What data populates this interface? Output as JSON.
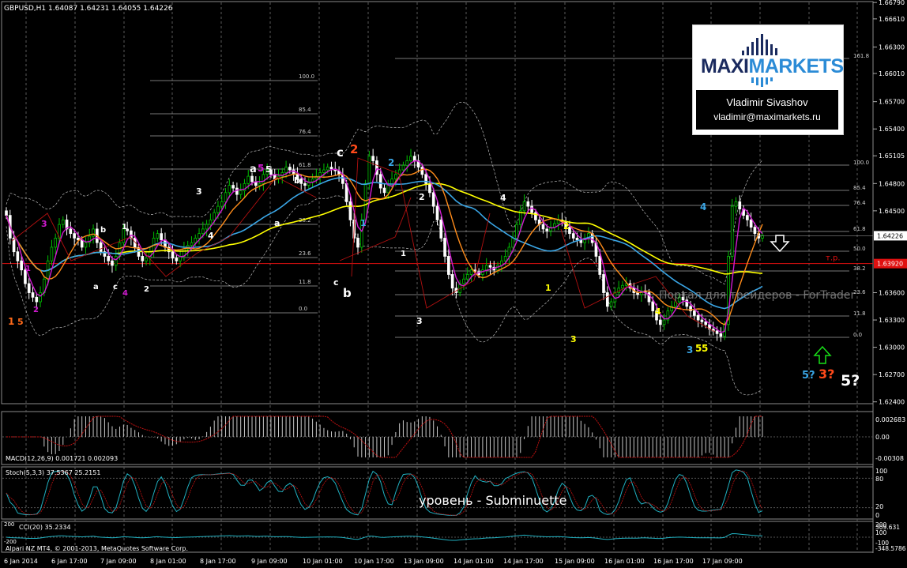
{
  "window": {
    "symbol_header": "GBPUSD,H1  1.64087 1.64231 1.64055 1.64226",
    "footer": "Alpari NZ MT4, © 2001-2013, MetaQuotes Software Corp."
  },
  "logo": {
    "brand_left": "MAXI",
    "brand_right": "MARKETS",
    "author_name": "Vladimir Sivashov",
    "author_email": "vladimir@maximarkets.ru"
  },
  "watermark": "Портал для трейдеров - ForTrader",
  "level_caption": "уровень - Subminuette",
  "colors": {
    "bg": "#000000",
    "grid": "#5a5a5a",
    "bull": "#00c000",
    "bear": "#ffffff",
    "ma_yellow": "#ffff00",
    "ma_blue": "#3aa6e6",
    "ma_orange": "#ff8c1a",
    "ma_magenta": "#d01ad0",
    "tp_line": "#e01010",
    "fib_line": "#a0a0a0",
    "macd": "#c01010",
    "stoch": "#20b0c0",
    "cci": "#20b0c0"
  },
  "chart_data": [
    {
      "type": "candlestick",
      "symbol": "GBPUSD",
      "timeframe": "H1",
      "ohlc_header": {
        "open": 1.64087,
        "high": 1.64231,
        "low": 1.64055,
        "close": 1.64226
      },
      "ylim": [
        1.6238,
        1.668
      ],
      "y_ticks": [
        "1.66790",
        "1.66610",
        "1.66300",
        "1.66010",
        "1.65700",
        "1.65400",
        "1.65105",
        "1.64800",
        "1.64500",
        "1.64226",
        "1.63920",
        "1.63600",
        "1.63300",
        "1.63000",
        "1.62700",
        "1.62400"
      ],
      "current_price_label": "1.64226",
      "tp_price_label": "1.63920",
      "tp_label": "т.р.",
      "x_ticks": [
        "6 Jan 2014",
        "6 Jan 17:00",
        "7 Jan 09:00",
        "8 Jan 01:00",
        "8 Jan 17:00",
        "9 Jan 09:00",
        "10 Jan 01:00",
        "10 Jan 17:00",
        "13 Jan 09:00",
        "14 Jan 01:00",
        "14 Jan 17:00",
        "15 Jan 09:00",
        "16 Jan 01:00",
        "16 Jan 17:00",
        "17 Jan 09:00"
      ],
      "closes": [
        1.6445,
        1.642,
        1.6405,
        1.6395,
        1.6385,
        1.637,
        1.636,
        1.6355,
        1.635,
        1.636,
        1.6375,
        1.6395,
        1.641,
        1.642,
        1.6435,
        1.644,
        1.643,
        1.6425,
        1.642,
        1.6418,
        1.641,
        1.6415,
        1.6422,
        1.643,
        1.6415,
        1.6405,
        1.64,
        1.6395,
        1.639,
        1.64,
        1.6415,
        1.643,
        1.6428,
        1.642,
        1.641,
        1.64,
        1.6395,
        1.6398,
        1.6405,
        1.642,
        1.6425,
        1.6418,
        1.641,
        1.6405,
        1.6398,
        1.6395,
        1.64,
        1.6408,
        1.6412,
        1.6415,
        1.642,
        1.6425,
        1.643,
        1.6435,
        1.644,
        1.6448,
        1.6455,
        1.646,
        1.647,
        1.6478,
        1.6475,
        1.6468,
        1.6472,
        1.648,
        1.6488,
        1.6482,
        1.6478,
        1.648,
        1.649,
        1.6495,
        1.649,
        1.6485,
        1.6488,
        1.6492,
        1.6498,
        1.6495,
        1.649,
        1.6485,
        1.648,
        1.6478,
        1.6482,
        1.6485,
        1.6488,
        1.6492,
        1.6495,
        1.6498,
        1.6496,
        1.6494,
        1.649,
        1.648,
        1.646,
        1.644,
        1.642,
        1.641,
        1.644,
        1.648,
        1.651,
        1.6505,
        1.649,
        1.6475,
        1.647,
        1.6478,
        1.6485,
        1.649,
        1.6495,
        1.65,
        1.6505,
        1.651,
        1.6505,
        1.6498,
        1.649,
        1.648,
        1.647,
        1.6455,
        1.644,
        1.642,
        1.64,
        1.638,
        1.6365,
        1.636,
        1.637,
        1.6375,
        1.638,
        1.6385,
        1.6383,
        1.638,
        1.6385,
        1.639,
        1.6388,
        1.6385,
        1.639,
        1.6395,
        1.64,
        1.641,
        1.642,
        1.6435,
        1.645,
        1.646,
        1.6455,
        1.6448,
        1.644,
        1.6435,
        1.643,
        1.6428,
        1.6432,
        1.6436,
        1.644,
        1.6438,
        1.6432,
        1.6425,
        1.642,
        1.6418,
        1.6415,
        1.642,
        1.6425,
        1.6415,
        1.64,
        1.638,
        1.636,
        1.6345,
        1.635,
        1.636,
        1.6365,
        1.6368,
        1.637,
        1.6365,
        1.636,
        1.6358,
        1.6362,
        1.636,
        1.635,
        1.634,
        1.633,
        1.6325,
        1.633,
        1.634,
        1.6345,
        1.635,
        1.6355,
        1.6352,
        1.6345,
        1.634,
        1.6335,
        1.633,
        1.6328,
        1.6325,
        1.632,
        1.6318,
        1.6315,
        1.6312,
        1.6325,
        1.64,
        1.6455,
        1.646,
        1.6452,
        1.6445,
        1.644,
        1.6432,
        1.6425,
        1.642,
        1.6423
      ]
    },
    {
      "type": "line",
      "name": "MACD(12,26,9) 0.001721 0.002093",
      "y_ticks": [
        "0.002683",
        "0.00",
        "-0.00308"
      ]
    },
    {
      "type": "line",
      "name": "Stoch(5,3,3) 37.5367 25.2151",
      "y_ticks": [
        "100",
        "80",
        "20",
        "0"
      ]
    },
    {
      "type": "line",
      "name": "CCI(20) 35.2334",
      "y_ticks": [
        "200",
        "309.631",
        "100",
        "-100",
        "-348.5786"
      ],
      "left_ticks": [
        "200",
        "-200"
      ]
    }
  ],
  "fib_left": [
    "100.0",
    "85.4",
    "76.4",
    "61.8",
    "38.2",
    "23.6",
    "11.8",
    "0.0"
  ],
  "fib_right": [
    "161.8",
    "100.0",
    "85.4",
    "76.4",
    "61.8",
    "50.0",
    "38.2",
    "23.6",
    "11.8",
    "0.0"
  ],
  "wave_labels": [
    {
      "text": "1",
      "color": "#ff6a1a"
    },
    {
      "text": "5",
      "color": "#ff6a1a"
    },
    {
      "text": "3",
      "color": "#d01ad0"
    },
    {
      "text": "1",
      "color": "#d01ad0"
    },
    {
      "text": "2",
      "color": "#d01ad0"
    },
    {
      "text": "b",
      "color": "#ffffff"
    },
    {
      "text": "1",
      "color": "#ffffff"
    },
    {
      "text": "a",
      "color": "#ffffff"
    },
    {
      "text": "c",
      "color": "#ffffff"
    },
    {
      "text": "4",
      "color": "#d01ad0"
    },
    {
      "text": "2",
      "color": "#ffffff"
    },
    {
      "text": "3",
      "color": "#ffffff"
    },
    {
      "text": "4",
      "color": "#ffffff"
    },
    {
      "text": "a",
      "color": "#ffffff"
    },
    {
      "text": "5",
      "color": "#d01ad0"
    },
    {
      "text": "5",
      "color": "#ffffff"
    },
    {
      "text": "b",
      "color": "#ffffff"
    },
    {
      "text": "a",
      "color": "#ffffff"
    },
    {
      "text": "c",
      "color": "#ffffff"
    },
    {
      "text": "2",
      "color": "#ff4a1a"
    },
    {
      "text": "1",
      "color": "#3aa6e6"
    },
    {
      "text": "c",
      "color": "#ffffff"
    },
    {
      "text": "b",
      "color": "#ffffff"
    },
    {
      "text": "2",
      "color": "#3aa6e6"
    },
    {
      "text": "2",
      "color": "#ffffff"
    },
    {
      "text": "1",
      "color": "#ffffff"
    },
    {
      "text": "3",
      "color": "#ffffff"
    },
    {
      "text": "4",
      "color": "#ffffff"
    },
    {
      "text": "2",
      "color": "#ffff00"
    },
    {
      "text": "1",
      "color": "#ffff00"
    },
    {
      "text": "3",
      "color": "#ffff00"
    },
    {
      "text": "4",
      "color": "#ffff00"
    },
    {
      "text": "4",
      "color": "#3aa6e6"
    },
    {
      "text": "3",
      "color": "#3aa6e6"
    },
    {
      "text": "5",
      "color": "#ffff00"
    },
    {
      "text": "5",
      "color": "#ffff00"
    },
    {
      "text": "5?",
      "color": "#3aa6e6"
    },
    {
      "text": "3?",
      "color": "#ff4a1a"
    },
    {
      "text": "5?",
      "color": "#ffffff"
    }
  ]
}
